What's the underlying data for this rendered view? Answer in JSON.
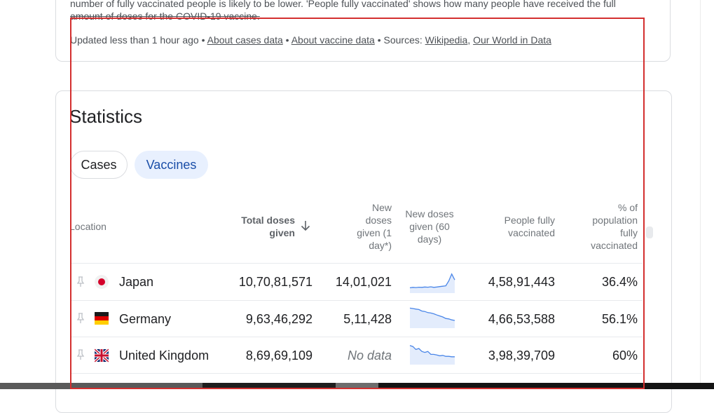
{
  "info": {
    "note_line1": "number of fully vaccinated people is likely to be lower. 'People fully vaccinated' shows how many people have received the full",
    "note_line2": "amount of doses for the COVID-19 vaccine.",
    "updated_text": "Updated less than 1 hour ago • ",
    "about_cases_link": "About cases data",
    "separator1": " • ",
    "about_vaccine_link": "About vaccine data",
    "sources_prefix": " • Sources: ",
    "source_wikipedia": "Wikipedia",
    "source_comma": ", ",
    "source_owid": "Our World in Data"
  },
  "statistics": {
    "title": "Statistics",
    "tabs": [
      {
        "label": "Cases",
        "selected": false
      },
      {
        "label": "Vaccines",
        "selected": true
      }
    ],
    "columns": {
      "location": "Location",
      "total_doses_line1": "Total doses",
      "total_doses_line2": "given",
      "new_doses_lines": [
        "New",
        "doses",
        "given (1",
        "day*)"
      ],
      "trend_lines": [
        "New doses",
        "given (60",
        "days)"
      ],
      "fully_lines": [
        "People fully",
        "vaccinated"
      ],
      "pct_lines": [
        "% of",
        "population",
        "fully",
        "vaccinated"
      ],
      "sort_icon": "arrow-down-icon"
    },
    "rows": [
      {
        "country": "Japan",
        "flag": "japan-flag-icon",
        "total": "10,70,81,571",
        "new": "14,01,021",
        "fully": "4,58,91,443",
        "pct": "36.4%",
        "trend": [
          0.2,
          0.22,
          0.21,
          0.23,
          0.22,
          0.24,
          0.23,
          0.25,
          0.22,
          0.24,
          0.26,
          0.28,
          0.3,
          0.55,
          0.9,
          0.6
        ]
      },
      {
        "country": "Germany",
        "flag": "germany-flag-icon",
        "total": "9,63,46,292",
        "new": "5,11,428",
        "fully": "4,66,53,588",
        "pct": "56.1%",
        "trend": [
          0.95,
          0.93,
          0.9,
          0.88,
          0.8,
          0.78,
          0.72,
          0.7,
          0.66,
          0.6,
          0.55,
          0.5,
          0.42,
          0.4,
          0.35,
          0.32
        ]
      },
      {
        "country": "United Kingdom",
        "flag": "uk-flag-icon",
        "total": "8,69,69,109",
        "new": "No data",
        "fully": "3,98,39,709",
        "pct": "60%",
        "trend": [
          0.9,
          0.85,
          0.7,
          0.75,
          0.6,
          0.55,
          0.6,
          0.45,
          0.45,
          0.42,
          0.38,
          0.4,
          0.35,
          0.35,
          0.33,
          0.33
        ]
      }
    ]
  },
  "colors": {
    "accent": "#1a73e8",
    "chip_selected_bg": "#e8f0fe",
    "spark_line": "#4a86e8",
    "spark_fill": "#e3ecfc",
    "highlight": "#d32f2f"
  }
}
